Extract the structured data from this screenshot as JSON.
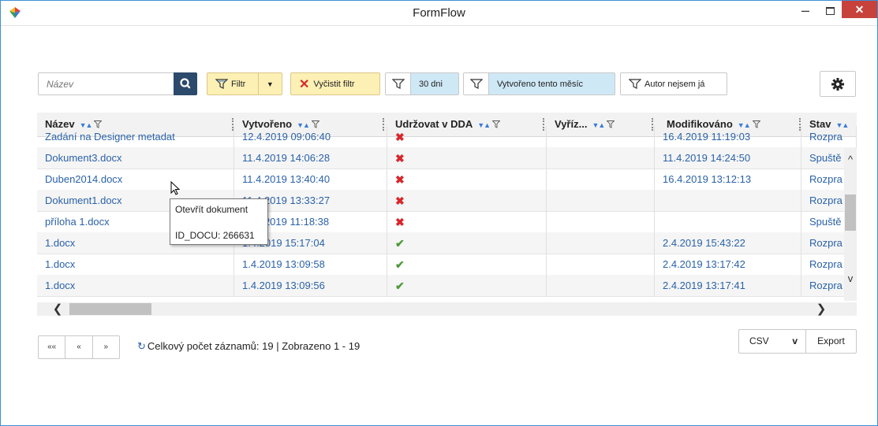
{
  "window": {
    "title": "FormFlow"
  },
  "toolbar": {
    "search_placeholder": "Název",
    "filter_label": "Filtr",
    "clear_filter_label": "Vyčistit filtr",
    "days_label": "30 dni",
    "created_month_label": "Vytvořeno tento měsíc",
    "author_label": "Autor nejsem já"
  },
  "columns": [
    {
      "label": "Název"
    },
    {
      "label": "Vytvořeno"
    },
    {
      "label": "Udržovat v DDA"
    },
    {
      "label": "Vyříz..."
    },
    {
      "label": "Modifikováno"
    },
    {
      "label": "Stav"
    }
  ],
  "rows": [
    {
      "name": "Zadání na Designer metadat",
      "created": "12.4.2019 09:06:40",
      "keep": "x",
      "done": "",
      "modified": "16.4.2019 11:19:03",
      "state": "Rozpra"
    },
    {
      "name": "Dokument3.docx",
      "created": "11.4.2019 14:06:28",
      "keep": "x",
      "done": "",
      "modified": "11.4.2019 14:24:50",
      "state": "Spuště"
    },
    {
      "name": "Duben2014.docx",
      "created": "11.4.2019 13:40:40",
      "keep": "x",
      "done": "",
      "modified": "16.4.2019 13:12:13",
      "state": "Rozpra"
    },
    {
      "name": "Dokument1.docx",
      "created": "11.4.2019 13:33:27",
      "keep": "x",
      "done": "",
      "modified": "",
      "state": "Rozpra"
    },
    {
      "name": "příloha 1.docx",
      "created": "11.4.2019 11:18:38",
      "keep": "x",
      "done": "",
      "modified": "",
      "state": "Spuště"
    },
    {
      "name": "1.docx",
      "created": "1.4.2019 15:17:04",
      "keep": "ok",
      "done": "",
      "modified": "2.4.2019 15:43:22",
      "state": "Rozpra"
    },
    {
      "name": "1.docx",
      "created": "1.4.2019 13:09:58",
      "keep": "ok",
      "done": "",
      "modified": "2.4.2019 13:17:42",
      "state": "Rozpra"
    },
    {
      "name": "1.docx",
      "created": "1.4.2019 13:09:56",
      "keep": "ok",
      "done": "",
      "modified": "2.4.2019 13:17:41",
      "state": "Rozpra"
    }
  ],
  "tooltip": {
    "line1": "Otevřít dokument",
    "line2": "ID_DOCU: 266631"
  },
  "footer": {
    "pager_first": "«« ",
    "pager_prev": "«",
    "pager_next": "»",
    "summary": "Celkový počet záznamů: 19 | Zobrazeno 1 - 19",
    "export_format": "CSV",
    "export_label": "Export"
  },
  "colors": {
    "accent": "#2c4a6b",
    "link": "#2a62a8",
    "yellow": "#fdf0b5",
    "chip_blue": "#cfe8f6",
    "close": "#c7423b"
  }
}
